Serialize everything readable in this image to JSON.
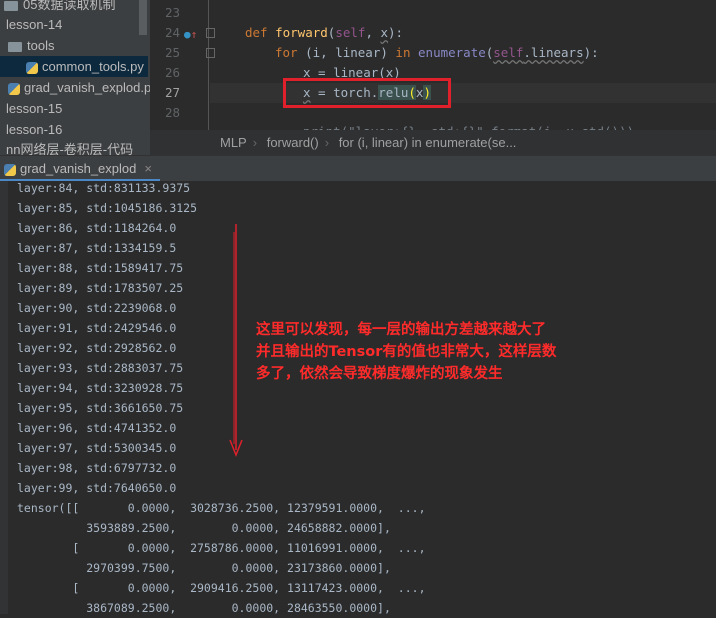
{
  "project_tree": {
    "items": [
      {
        "label": "05数据读取机制",
        "type": "folder"
      },
      {
        "label": "lesson-14",
        "type": "folder"
      },
      {
        "label": "tools",
        "type": "folder"
      },
      {
        "label": "common_tools.py",
        "type": "file",
        "selected": true
      },
      {
        "label": "grad_vanish_explod.py",
        "type": "file"
      },
      {
        "label": "lesson-15",
        "type": "folder"
      },
      {
        "label": "lesson-16",
        "type": "folder"
      },
      {
        "label": "nn网络层-卷积层-代码",
        "type": "folder"
      }
    ]
  },
  "editor": {
    "line_numbers": [
      "23",
      "24",
      "25",
      "26",
      "27",
      "28"
    ],
    "lines": {
      "l24": {
        "kw": "def",
        "fn": "forward",
        "open": "(",
        "self": "self",
        ", ": ", ",
        "x": "x",
        "close": "):"
      },
      "l25": {
        "kw": "for",
        "mid": " (i, linear) ",
        "in": "in",
        "sp": " ",
        "bi": "enumerate",
        "open": "(",
        "self": "self",
        ".linears": ".linears",
        "close": "):"
      },
      "l26": "x = linear(x)",
      "l27": {
        "x": "x",
        "eq": " = torch.",
        "relu": "relu",
        "po": "(",
        "arg": "x",
        "pc": ")"
      },
      "l29": "print(\"layer:{}, std:{}\".format(i, x.std()))"
    },
    "highlight_color": "#e0202a"
  },
  "breadcrumb": [
    "MLP",
    "forward()",
    "for (i, linear) in enumerate(se..."
  ],
  "run_tab": {
    "label": "grad_vanish_explod",
    "close": "×"
  },
  "console": {
    "lines": [
      "layer:84, std:831133.9375",
      "layer:85, std:1045186.3125",
      "layer:86, std:1184264.0",
      "layer:87, std:1334159.5",
      "layer:88, std:1589417.75",
      "layer:89, std:1783507.25",
      "layer:90, std:2239068.0",
      "layer:91, std:2429546.0",
      "layer:92, std:2928562.0",
      "layer:93, std:2883037.75",
      "layer:94, std:3230928.75",
      "layer:95, std:3661650.75",
      "layer:96, std:4741352.0",
      "layer:97, std:5300345.0",
      "layer:98, std:6797732.0",
      "layer:99, std:7640650.0",
      "tensor([[       0.0000,  3028736.2500, 12379591.0000,  ...,",
      "          3593889.2500,        0.0000, 24658882.0000],",
      "        [       0.0000,  2758786.0000, 11016991.0000,  ...,",
      "          2970399.7500,        0.0000, 23173860.0000],",
      "        [       0.0000,  2909416.2500, 13117423.0000,  ...,",
      "          3867089.2500,        0.0000, 28463550.0000],"
    ]
  },
  "annotation": {
    "text_lines": [
      "这里可以发现，每一层的输出方差越来越大了",
      "并且输出的Tensor有的值也非常大，这样层数",
      "多了，依然会导致梯度爆炸的现象发生"
    ],
    "color": "#ff2b2b"
  }
}
